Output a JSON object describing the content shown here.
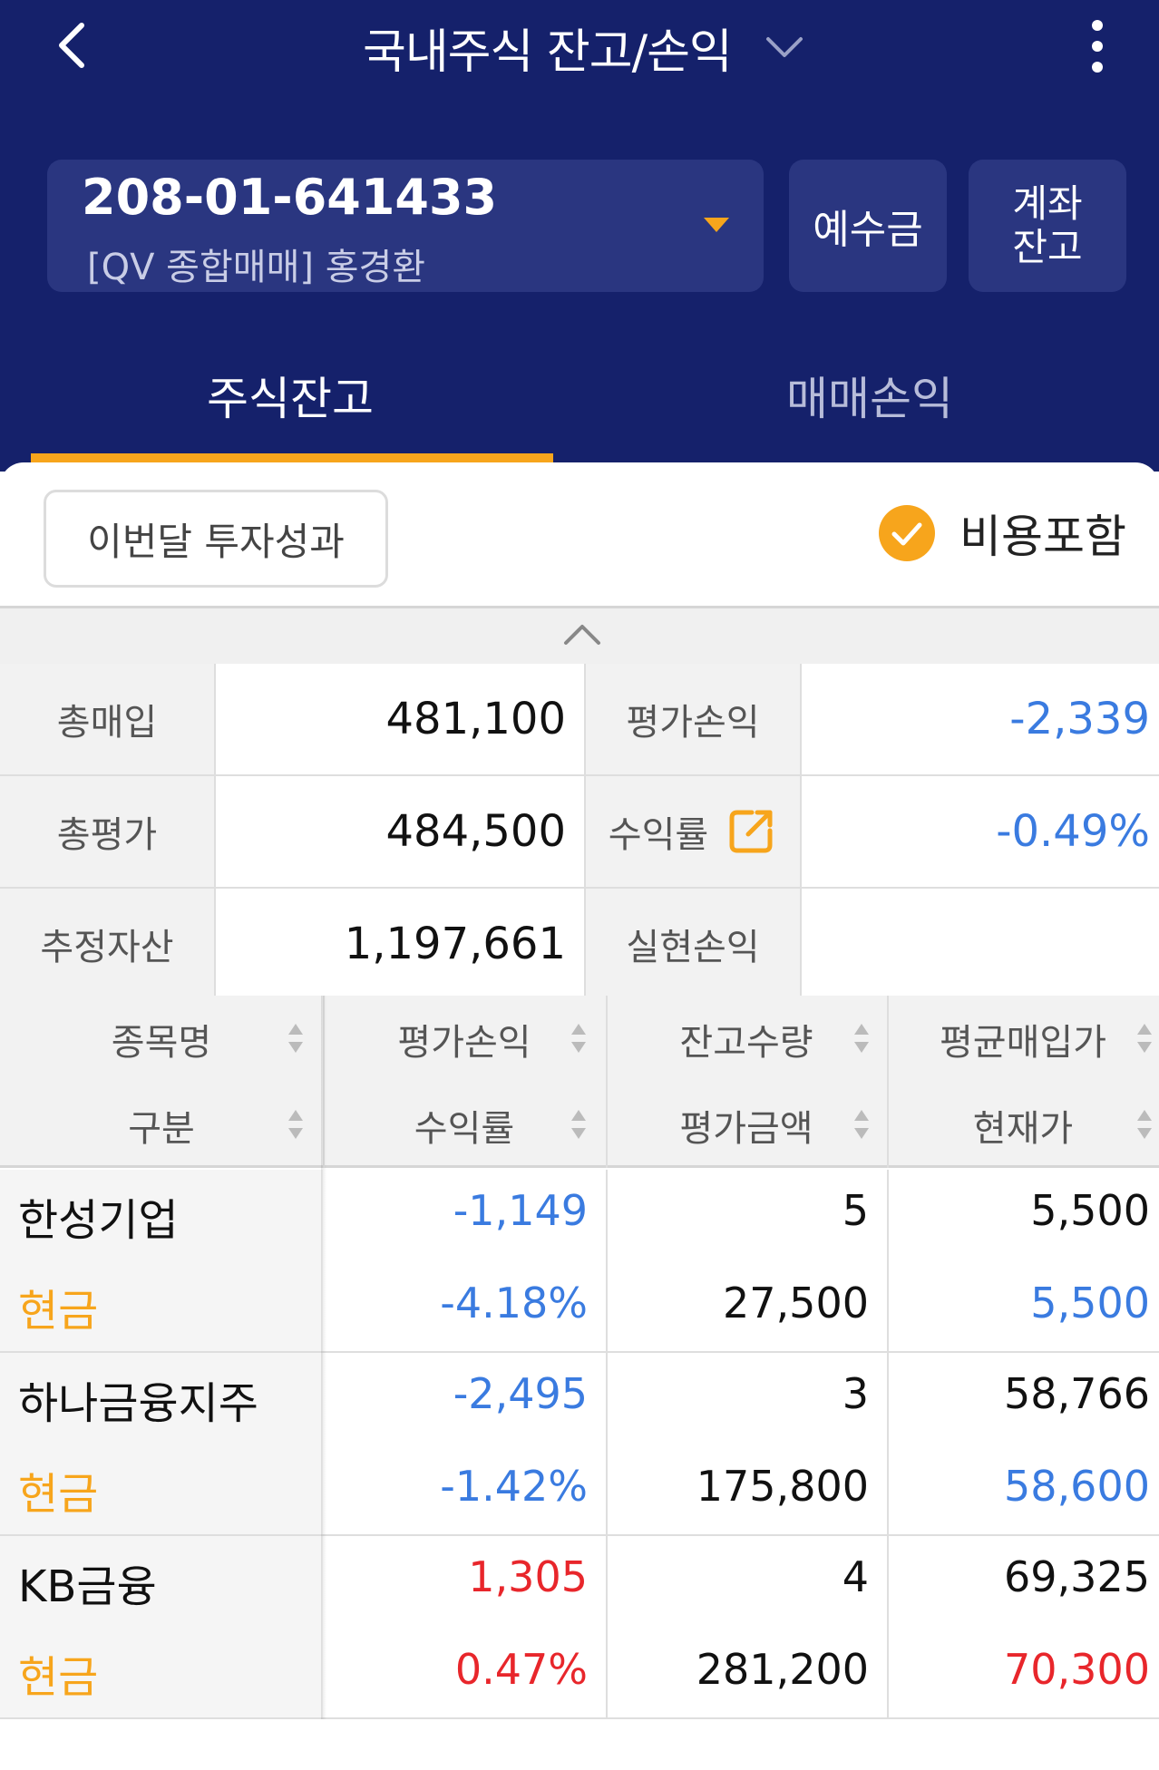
{
  "header": {
    "title": "국내주식 잔고/손익",
    "account_number": "208-01-641433",
    "account_name": "[QV 종합매매]  홍경환",
    "deposit_button": "예수금",
    "balance_button_line1": "계좌",
    "balance_button_line2": "잔고"
  },
  "tabs": [
    {
      "label": "주식잔고",
      "active": true
    },
    {
      "label": "매매손익",
      "active": false
    }
  ],
  "colors": {
    "navy": "#15216b",
    "accent": "#f7a51c",
    "positive": "#e8262b",
    "negative": "#3a7be0"
  },
  "controls": {
    "month_performance": "이번달 투자성과",
    "include_fees": "비용포함",
    "include_fees_checked": true
  },
  "summary": [
    {
      "label1": "총매입",
      "value1": "481,100",
      "label2": "평가손익",
      "value2": "-2,339"
    },
    {
      "label1": "총평가",
      "value1": "484,500",
      "label2": "수익률",
      "value2": "-0.49%"
    },
    {
      "label1": "추정자산",
      "value1": "1,197,661",
      "label2": "실현손익",
      "value2": ""
    }
  ],
  "table_headers": {
    "row1": [
      "종목명",
      "평가손익",
      "잔고수량",
      "평균매입가"
    ],
    "row2": [
      "구분",
      "수익률",
      "평가금액",
      "현재가"
    ]
  },
  "holdings": [
    {
      "name": "한성기업",
      "category": "현금",
      "pnl": "-1,149",
      "rate": "-4.18%",
      "qty": "5",
      "eval": "27,500",
      "avg_price": "5,500",
      "cur_price": "5,500"
    },
    {
      "name": "하나금융지주",
      "category": "현금",
      "pnl": "-2,495",
      "rate": "-1.42%",
      "qty": "3",
      "eval": "175,800",
      "avg_price": "58,766",
      "cur_price": "58,600"
    },
    {
      "name": "KB금융",
      "category": "현금",
      "pnl": "1,305",
      "rate": "0.47%",
      "qty": "4",
      "eval": "281,200",
      "avg_price": "69,325",
      "cur_price": "70,300"
    }
  ]
}
